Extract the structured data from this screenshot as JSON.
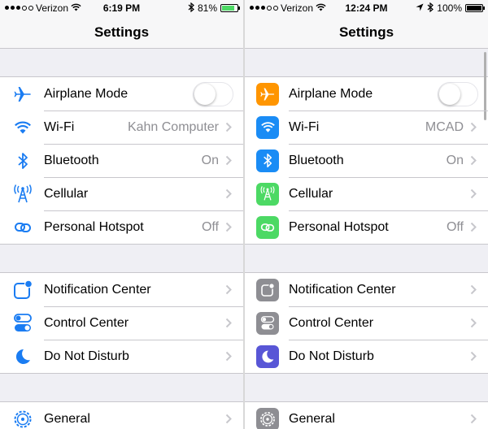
{
  "left": {
    "status": {
      "carrier": "Verizon",
      "time": "6:19 PM",
      "battery": "81%",
      "battery_level": 0.81
    },
    "title": "Settings",
    "group1": [
      {
        "label": "Airplane Mode",
        "value": "",
        "icon": "airplane-icon",
        "toggle": false
      },
      {
        "label": "Wi-Fi",
        "value": "Kahn Computer",
        "icon": "wifi-icon"
      },
      {
        "label": "Bluetooth",
        "value": "On",
        "icon": "bluetooth-icon"
      },
      {
        "label": "Cellular",
        "value": "",
        "icon": "cellular-icon"
      },
      {
        "label": "Personal Hotspot",
        "value": "Off",
        "icon": "hotspot-icon"
      }
    ],
    "group2": [
      {
        "label": "Notification Center",
        "icon": "notification-center-icon"
      },
      {
        "label": "Control Center",
        "icon": "control-center-icon"
      },
      {
        "label": "Do Not Disturb",
        "icon": "moon-icon"
      }
    ],
    "group3": [
      {
        "label": "General",
        "icon": "gear-icon"
      }
    ]
  },
  "right": {
    "status": {
      "carrier": "Verizon",
      "time": "12:24 PM",
      "battery": "100%",
      "battery_level": 1.0
    },
    "title": "Settings",
    "group1": [
      {
        "label": "Airplane Mode",
        "value": "",
        "icon": "airplane-icon",
        "toggle": false
      },
      {
        "label": "Wi-Fi",
        "value": "MCAD",
        "icon": "wifi-icon"
      },
      {
        "label": "Bluetooth",
        "value": "On",
        "icon": "bluetooth-icon"
      },
      {
        "label": "Cellular",
        "value": "",
        "icon": "cellular-icon"
      },
      {
        "label": "Personal Hotspot",
        "value": "Off",
        "icon": "hotspot-icon"
      }
    ],
    "group2": [
      {
        "label": "Notification Center",
        "icon": "notification-center-icon"
      },
      {
        "label": "Control Center",
        "icon": "control-center-icon"
      },
      {
        "label": "Do Not Disturb",
        "icon": "moon-icon"
      }
    ],
    "group3": [
      {
        "label": "General",
        "icon": "gear-icon"
      }
    ]
  },
  "colors": {
    "ios7_blue": "#1a7cf2",
    "airplane_orange": "#ff9500",
    "wifi_blue": "#1a8cf5",
    "bluetooth_blue": "#1a8cf5",
    "cellular_green": "#4cd964",
    "hotspot_green": "#4cd964",
    "notification_gray": "#8e8e93",
    "control_gray": "#8e8e93",
    "dnd_purple": "#5856d6",
    "general_gray": "#8e8e93"
  }
}
